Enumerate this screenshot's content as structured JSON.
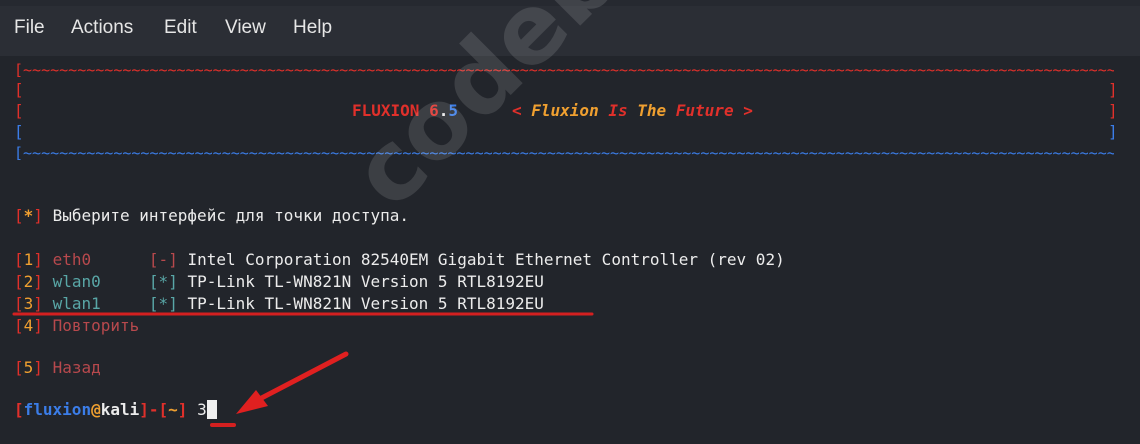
{
  "menu": [
    "File",
    "Actions",
    "Edit",
    "View",
    "Help"
  ],
  "banner": {
    "border": "[~~~~~~~~~~~~~~~~~~~~~~~~~~~~~~~~~~~~~~~~~~~~~~~~~~~~~~~~~~~~~~~~~~~~~~~~~~~~~~~~~~~~~~~~~~~~~~~~~~~~~~~~~~~~~~~~~~~~~~~~~~~~~~~~~~~]",
    "name": "FLUXION 6",
    "version_dot": ".",
    "version_minor": "5",
    "tagline_open": "< ",
    "tagline_w1": "Fluxion",
    "tagline_w2": " Is ",
    "tagline_w3": "The",
    "tagline_w4": " Future",
    "tagline_close": " >"
  },
  "prompt": {
    "marker": "*",
    "text": "Выберите интерфейс для точки доступа."
  },
  "interfaces": [
    {
      "num": "1",
      "name": "eth0 ",
      "status": "-",
      "description": "Intel Corporation 82540EM Gigabit Ethernet Controller (rev 02)"
    },
    {
      "num": "2",
      "name": "wlan0",
      "status": "*",
      "description": "TP-Link TL-WN821N Version 5 RTL8192EU"
    },
    {
      "num": "3",
      "name": "wlan1",
      "status": "*",
      "description": "TP-Link TL-WN821N Version 5 RTL8192EU"
    }
  ],
  "options": [
    {
      "num": "4",
      "label": "Повторить"
    },
    {
      "num": "5",
      "label": "Назад"
    }
  ],
  "shell": {
    "user": "fluxion",
    "at": "@",
    "host": "kali",
    "dir": "~",
    "input": "3"
  },
  "watermark": "codeby.net",
  "colors": {
    "background": "#22252b",
    "menubar": "#2b2e35",
    "red": "#e0302b",
    "blue": "#3b7de8",
    "orange": "#f0a030"
  }
}
